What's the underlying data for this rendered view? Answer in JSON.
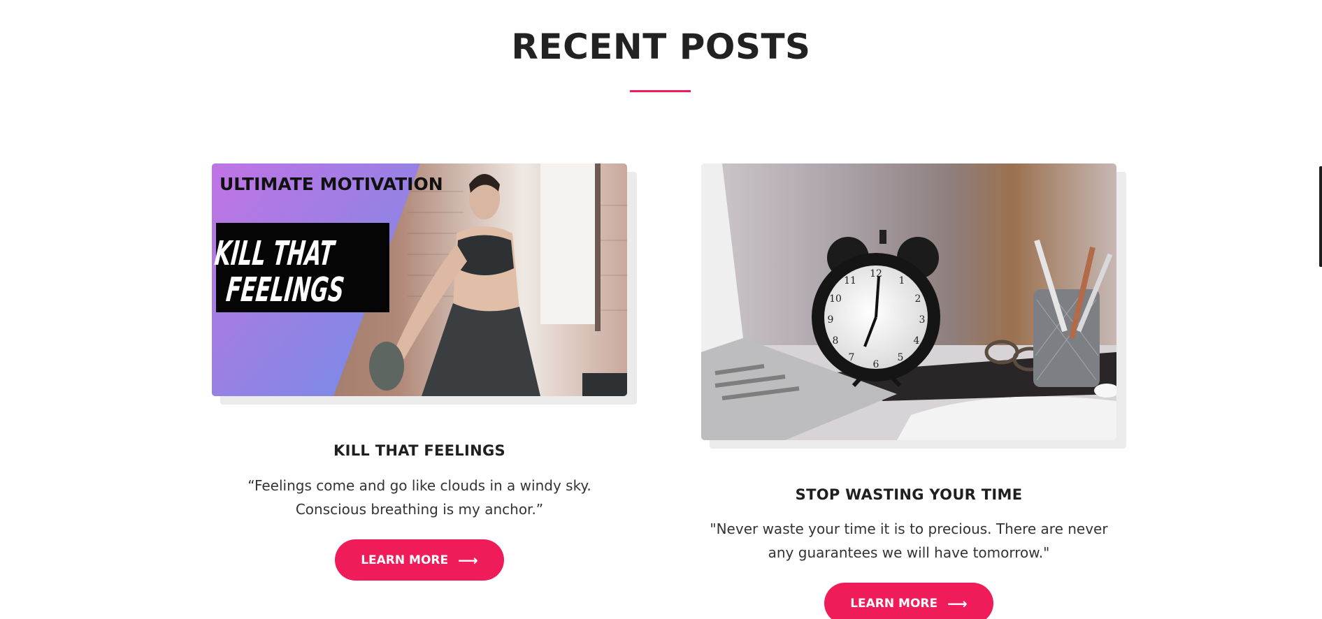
{
  "section": {
    "title": "RECENT POSTS",
    "accent_color": "#f01c5a"
  },
  "posts": [
    {
      "title": "KILL THAT FEELINGS",
      "excerpt": "“Feelings come and go like clouds in a windy sky. Conscious breathing is my anchor.”",
      "button_label": "LEARN MORE",
      "button_icon": "arrow-right-icon",
      "image": {
        "banner_text": "ULTIMATE MOTIVATION",
        "headline_line1": "KILL THAT",
        "headline_line2": "FEELINGS"
      }
    },
    {
      "title": "STOP WASTING YOUR TIME",
      "excerpt": "\"Never waste your time it is to precious. There are never any guarantees we will have tomorrow.\"",
      "button_label": "LEARN MORE",
      "button_icon": "arrow-right-icon"
    }
  ]
}
